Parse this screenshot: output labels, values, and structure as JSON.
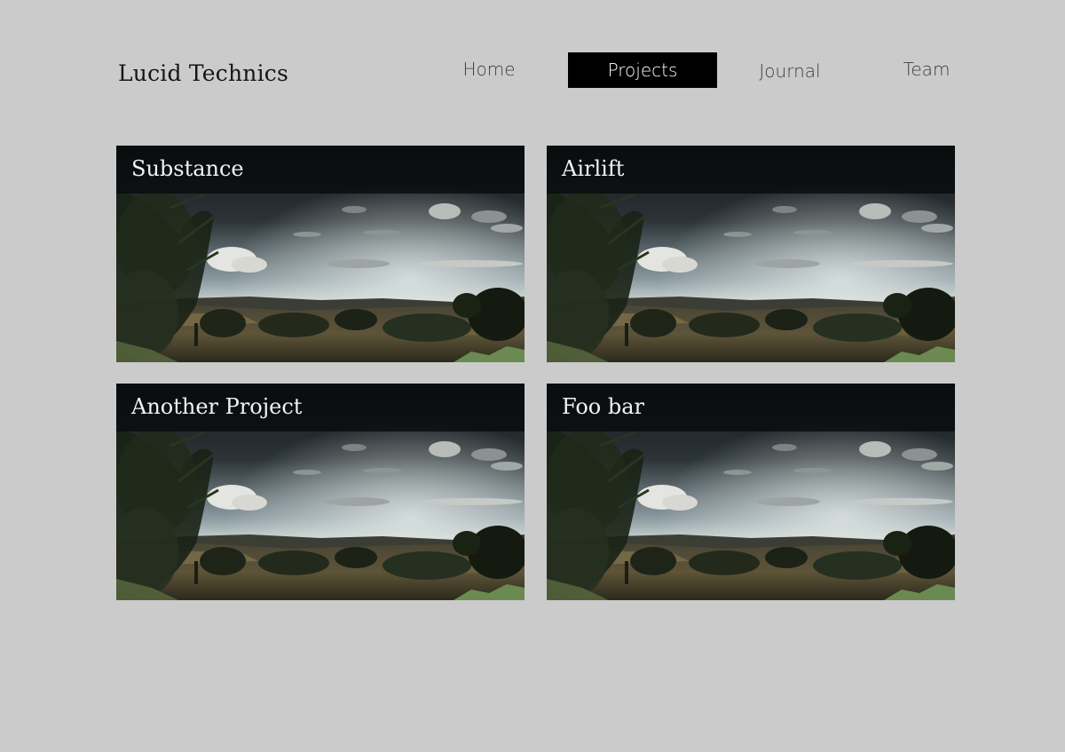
{
  "site": {
    "title": "Lucid Technics"
  },
  "nav": {
    "items": [
      {
        "label": "Home"
      },
      {
        "label": "Projects",
        "active": true
      },
      {
        "label": "Journal"
      },
      {
        "label": "Team"
      }
    ]
  },
  "projects": [
    {
      "title": "Substance",
      "image": "landscape-photo"
    },
    {
      "title": "Airlift",
      "image": "landscape-photo"
    },
    {
      "title": "Another Project",
      "image": "landscape-photo"
    },
    {
      "title": "Foo bar",
      "image": "landscape-photo"
    }
  ],
  "colors": {
    "background": "#cbcbcb",
    "nav_active_bg": "#000000",
    "nav_active_text": "#ffffff",
    "nav_text": "#3e3e3e",
    "title_bar": "#0a0c0e"
  }
}
